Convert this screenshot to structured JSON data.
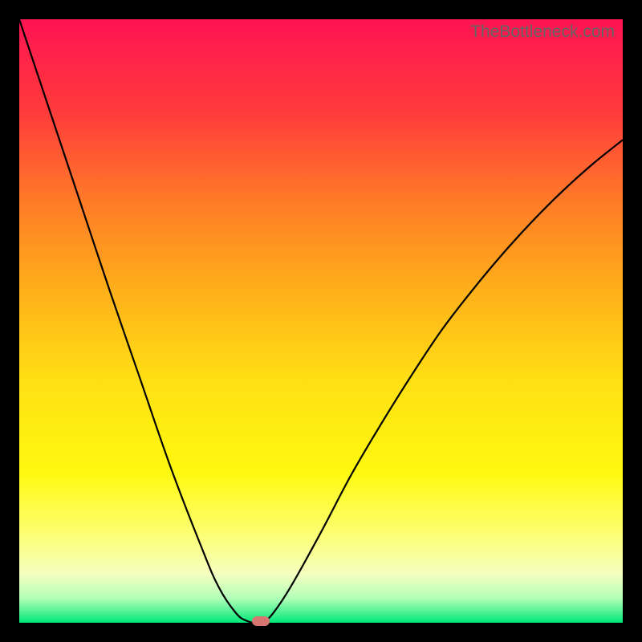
{
  "watermark": "TheBottleneck.com",
  "chart_data": {
    "type": "line",
    "title": "",
    "xlabel": "",
    "ylabel": "",
    "xlim": [
      0,
      100
    ],
    "ylim": [
      0,
      100
    ],
    "x": [
      0,
      5,
      10,
      15,
      20,
      25,
      30,
      33,
      36,
      38,
      39.5,
      40.5,
      42,
      45,
      50,
      55,
      60,
      65,
      70,
      75,
      80,
      85,
      90,
      95,
      100
    ],
    "values": [
      100,
      85,
      70,
      55,
      40.5,
      26,
      13,
      6,
      1.5,
      0.2,
      0,
      0.2,
      1.5,
      6,
      15,
      24.5,
      33,
      41,
      48.5,
      55,
      61,
      66.5,
      71.5,
      76,
      80
    ],
    "marker": {
      "x": 40,
      "y": 0.2
    },
    "gradient_notes": "vertical gradient red(top) to green(bottom)"
  }
}
